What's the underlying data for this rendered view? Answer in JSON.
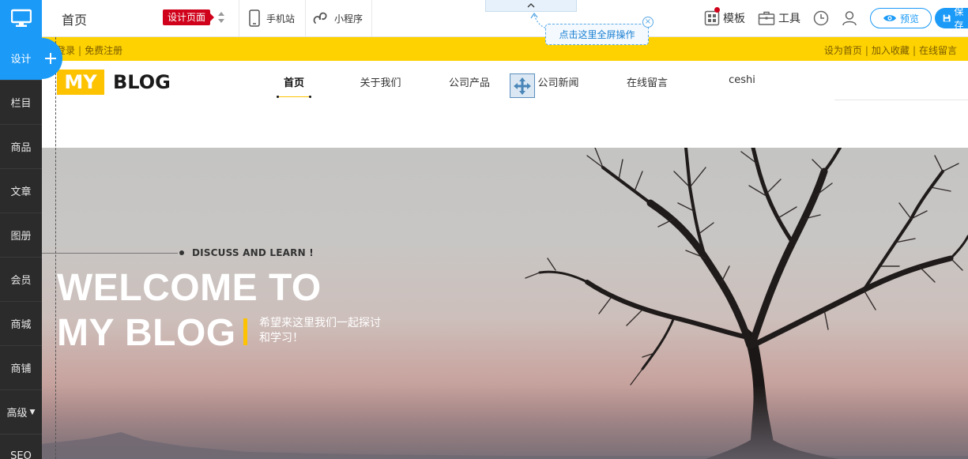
{
  "sidebar": {
    "items": [
      {
        "label": "设计",
        "active": true
      },
      {
        "label": "栏目"
      },
      {
        "label": "商品"
      },
      {
        "label": "文章"
      },
      {
        "label": "图册"
      },
      {
        "label": "会员"
      },
      {
        "label": "商城"
      },
      {
        "label": "商铺"
      },
      {
        "label": "高级",
        "has_caret": true
      },
      {
        "label": "SEO"
      }
    ]
  },
  "toolbar": {
    "page_title": "首页",
    "badge": "设计页面",
    "mobile_label": "手机站",
    "miniapp_label": "小程序",
    "template_label": "模板",
    "tools_label": "工具",
    "preview_label": "预览",
    "save_label": "保存"
  },
  "tooltip": {
    "text": "点击这里全屏操作"
  },
  "site": {
    "topbar": {
      "left": [
        "登录",
        "免费注册"
      ],
      "right": [
        "设为首页",
        "加入收藏",
        "在线留言"
      ]
    },
    "logo": {
      "part1": "MY",
      "part2": "BLOG"
    },
    "nav": [
      {
        "label": "首页",
        "active": true
      },
      {
        "label": "关于我们"
      },
      {
        "label": "公司产品"
      },
      {
        "label": "公司新闻"
      },
      {
        "label": "在线留言"
      },
      {
        "label": "ceshi"
      }
    ],
    "hero": {
      "kicker": "DISCUSS AND LEARN !",
      "title_line1": "WELCOME TO",
      "title_line2": "MY BLOG",
      "subtitle_line1": "希望来这里我们一起探讨",
      "subtitle_line2": "和学习！"
    }
  },
  "colors": {
    "accent_blue": "#1b9af7",
    "sidebar_bg": "#2b2b2b",
    "brand_yellow": "#fdd200",
    "badge_red": "#d0021b"
  }
}
